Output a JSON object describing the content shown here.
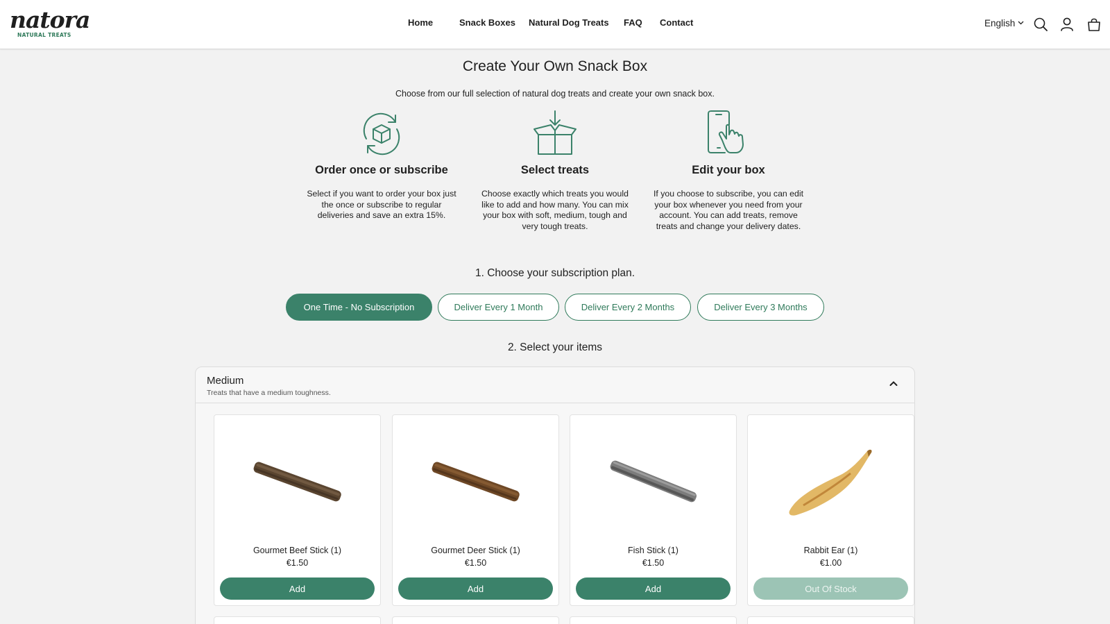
{
  "brand": {
    "name": "natora",
    "tagline": "NATURAL TREATS",
    "accent": "#3b826a",
    "accent_light": "#9cc4b5"
  },
  "nav": {
    "items": [
      "Home",
      "Snack Boxes",
      "Natural Dog Treats",
      "FAQ",
      "Contact"
    ]
  },
  "header": {
    "language": "English",
    "icons": [
      "search-icon",
      "account-icon",
      "cart-icon"
    ]
  },
  "intro": {
    "title": "Create Your Own Snack Box",
    "subtitle": "Choose from our full selection of natural dog treats and create your own snack box.",
    "steps": [
      {
        "icon": "subscribe-box-icon",
        "title": "Order once or subscribe",
        "lines": [
          "Select if you want to order your box just",
          "the once or subscribe to regular",
          "deliveries and save an extra 15%."
        ]
      },
      {
        "icon": "open-box-icon",
        "title": "Select treats",
        "lines": [
          "Choose exactly which treats you would",
          "like to add and how many. You can mix",
          "your box with soft, medium, tough and",
          "very tough treats."
        ]
      },
      {
        "icon": "phone-tap-icon",
        "title": "Edit your box",
        "lines": [
          "If you choose to subscribe, you can edit",
          "your box whenever you need from your",
          "account. You can add treats, remove",
          "treats and change your delivery dates."
        ]
      }
    ]
  },
  "plan": {
    "heading": "1. Choose your subscription plan.",
    "options": [
      "One Time - No Subscription",
      "Deliver Every 1 Month",
      "Deliver Every 2 Months",
      "Deliver Every 3 Months"
    ],
    "selected": "One Time - No Subscription"
  },
  "items": {
    "heading": "2. Select your items",
    "category": {
      "name": "Medium",
      "description": "Treats that have a medium toughness."
    },
    "products": [
      {
        "name": "Gourmet Beef Stick (1)",
        "price": "€1.50",
        "button": "Add",
        "image": "beef-stick"
      },
      {
        "name": "Gourmet Deer Stick (1)",
        "price": "€1.50",
        "button": "Add",
        "image": "deer-stick"
      },
      {
        "name": "Fish Stick (1)",
        "price": "€1.50",
        "button": "Add",
        "image": "fish-stick"
      },
      {
        "name": "Rabbit Ear (1)",
        "price": "€1.00",
        "button": "Out Of Stock",
        "image": "rabbit-ear"
      }
    ]
  }
}
